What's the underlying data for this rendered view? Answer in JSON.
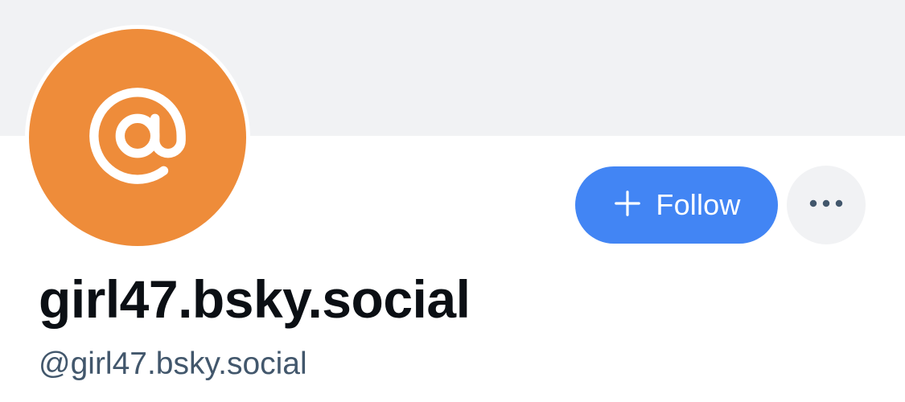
{
  "profile": {
    "display_name": "girl47.bsky.social",
    "handle": "@girl47.bsky.social",
    "avatar_icon": "at-sign-icon"
  },
  "actions": {
    "follow_label": "Follow",
    "follow_icon": "plus-icon",
    "more_icon": "more-horizontal-icon"
  },
  "colors": {
    "banner": "#f1f2f4",
    "avatar": "#ee8c3a",
    "follow_button": "#4285f4",
    "handle_text": "#42576c"
  }
}
